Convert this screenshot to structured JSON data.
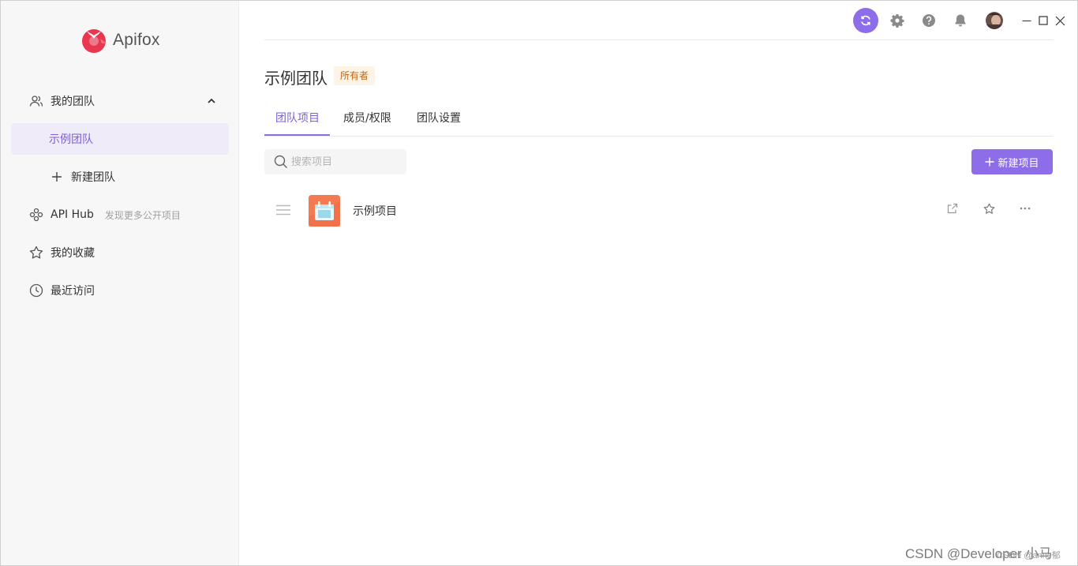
{
  "app": {
    "name": "Apifox"
  },
  "sidebar": {
    "my_team": "我的团队",
    "team_item": "示例团队",
    "new_team": "新建团队",
    "api_hub": "API Hub",
    "api_hub_sub": "发现更多公开项目",
    "favorites": "我的收藏",
    "recent": "最近访问"
  },
  "header": {
    "title": "示例团队",
    "badge": "所有者"
  },
  "tabs": [
    {
      "label": "团队项目",
      "active": true
    },
    {
      "label": "成员/权限",
      "active": false
    },
    {
      "label": "团队设置",
      "active": false
    }
  ],
  "search": {
    "placeholder": "搜索项目",
    "value": ""
  },
  "toolbar": {
    "new_project": "新建项目"
  },
  "projects": [
    {
      "name": "示例项目"
    }
  ],
  "watermark": {
    "text": "CSDN @Developer 小马",
    "sub": "CSDN @anne郁"
  },
  "colors": {
    "accent": "#8e6ee8",
    "active_bg": "#efebf8",
    "brand_red": "#e8374f",
    "project_icon": "#f47a52"
  }
}
